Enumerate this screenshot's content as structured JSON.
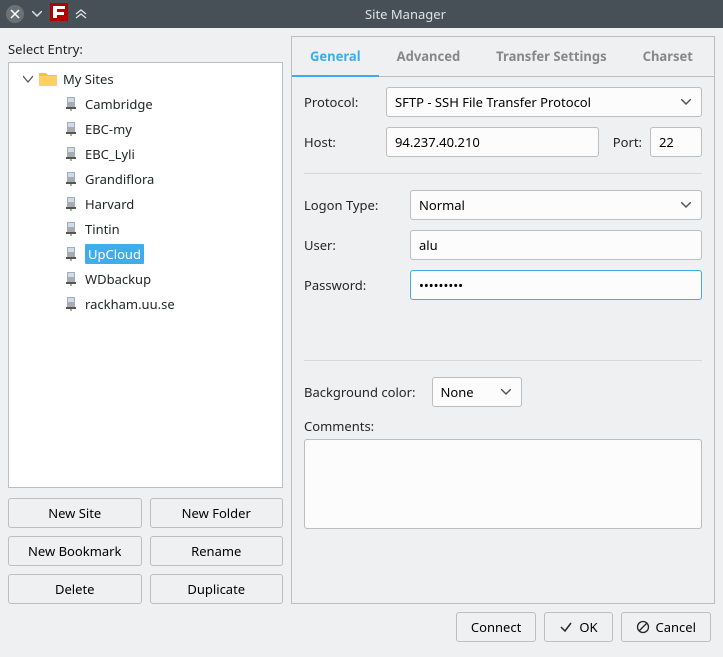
{
  "window": {
    "title": "Site Manager"
  },
  "left": {
    "select_label": "Select Entry:",
    "root_folder": "My Sites",
    "sites": [
      "Cambridge",
      "EBC-my",
      "EBC_Lyli",
      "Grandiflora",
      "Harvard",
      "Tintin",
      "UpCloud",
      "WDbackup",
      "rackham.uu.se"
    ],
    "selected_index": 6,
    "buttons": {
      "new_site": "New Site",
      "new_folder": "New Folder",
      "new_bookmark": "New Bookmark",
      "rename": "Rename",
      "delete": "Delete",
      "duplicate": "Duplicate"
    }
  },
  "tabs": [
    "General",
    "Advanced",
    "Transfer Settings",
    "Charset"
  ],
  "active_tab": 0,
  "form": {
    "labels": {
      "protocol": "Protocol:",
      "host": "Host:",
      "port": "Port:",
      "logon_type": "Logon Type:",
      "user": "User:",
      "password": "Password:",
      "bg": "Background color:",
      "comments": "Comments:"
    },
    "protocol": "SFTP - SSH File Transfer Protocol",
    "host": "94.237.40.210",
    "port": "22",
    "logon_type": "Normal",
    "user": "alu",
    "password": "•••••••••",
    "bg_color": "None",
    "comments": ""
  },
  "footer": {
    "connect": "Connect",
    "ok": "OK",
    "cancel": "Cancel"
  }
}
